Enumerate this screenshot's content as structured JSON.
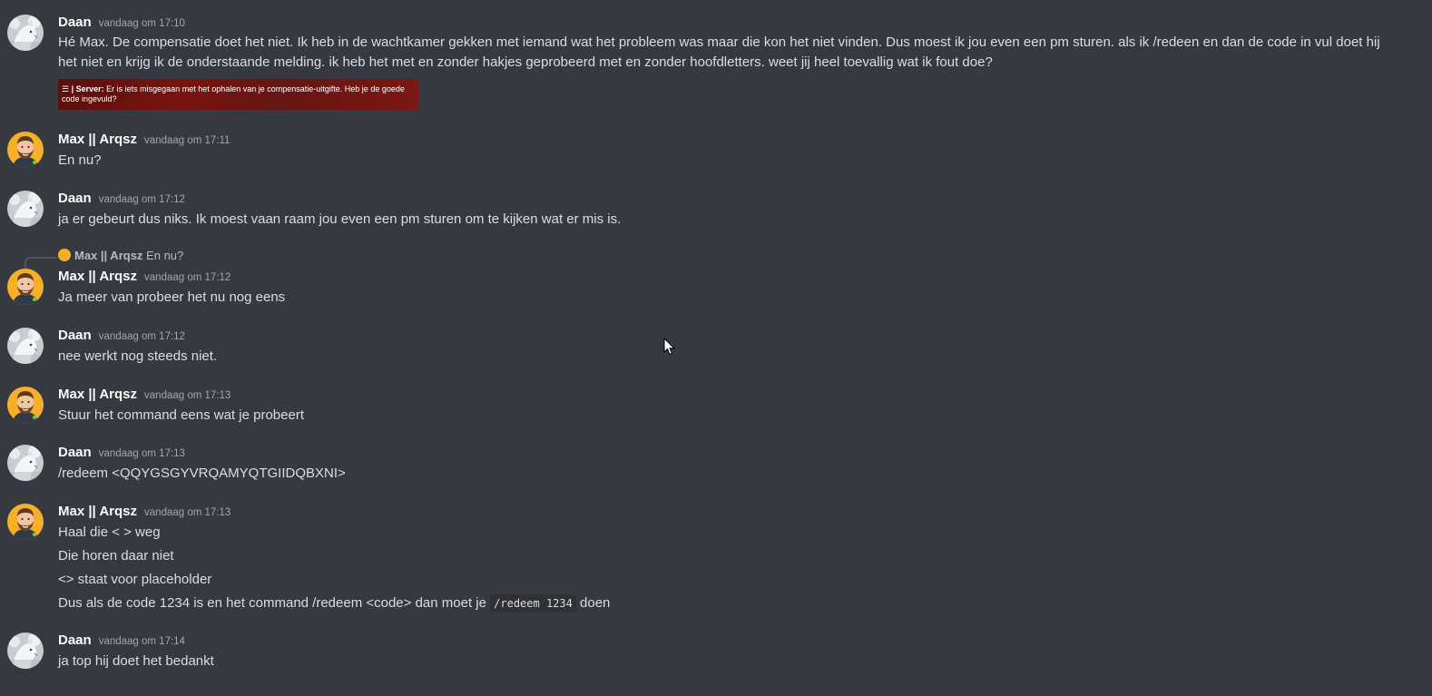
{
  "users": {
    "daan": {
      "name": "Daan"
    },
    "max": {
      "name": "Max || Arqsz"
    }
  },
  "messages": [
    {
      "author": "Daan",
      "time": "vandaag om 17:10",
      "text": "Hé Max. De compensatie doet het niet. Ik heb in de wachtkamer gekken met iemand wat het probleem was maar die kon het niet vinden. Dus moest ik jou even een pm sturen. als ik /redeen en dan de code in vul doet hij het niet en krijg ik de onderstaande melding. ik heb het met en zonder hakjes geprobeerd met en zonder hoofdletters. weet jij heel toevallig wat ik fout doe?",
      "embed": {
        "icon": "☰",
        "prefix": "| Server:",
        "text": "Er is iets misgegaan met het ophalen van je compensatie-uitgifte. Heb je de goede code ingevuld?"
      }
    },
    {
      "author": "Max || Arqsz",
      "time": "vandaag om 17:11",
      "text": "En nu?"
    },
    {
      "author": "Daan",
      "time": "vandaag om 17:12",
      "text": "ja er gebeurt dus niks. Ik moest vaan raam jou even een pm sturen om te kijken wat er mis is."
    },
    {
      "author": "Max || Arqsz",
      "time": "vandaag om 17:12",
      "reply": {
        "author": "Max || Arqsz",
        "text": "En nu?"
      },
      "text": "Ja meer van probeer het nu nog eens"
    },
    {
      "author": "Daan",
      "time": "vandaag om 17:12",
      "text": "nee werkt nog steeds niet."
    },
    {
      "author": "Max || Arqsz",
      "time": "vandaag om 17:13",
      "text": "Stuur het command eens wat je probeert"
    },
    {
      "author": "Daan",
      "time": "vandaag om 17:13",
      "text": "/redeem <QQYGSGYVRQAMYQTGIIDQBXNI>"
    },
    {
      "author": "Max || Arqsz",
      "time": "vandaag om 17:13",
      "lines": [
        "Haal die < > weg",
        "Die horen daar niet",
        "<> staat voor placeholder"
      ],
      "last_line": {
        "before": "Dus als de code 1234 is en het command /redeem <code> dan moet je",
        "code": "/redeem 1234",
        "after": "doen"
      }
    },
    {
      "author": "Daan",
      "time": "vandaag om 17:14",
      "text": "ja top hij doet het bedankt"
    }
  ],
  "colors": {
    "background": "#36393f",
    "username": "#ffffff",
    "timestamp": "#a3a6aa",
    "text": "#dcddde",
    "embed": "#7a1410",
    "max_avatar": "#f5b026"
  },
  "icons": {
    "daan_avatar": "snowy-wolf-avatar",
    "max_avatar": "bearded-man-avatar",
    "cursor": "mouse-pointer-icon"
  }
}
